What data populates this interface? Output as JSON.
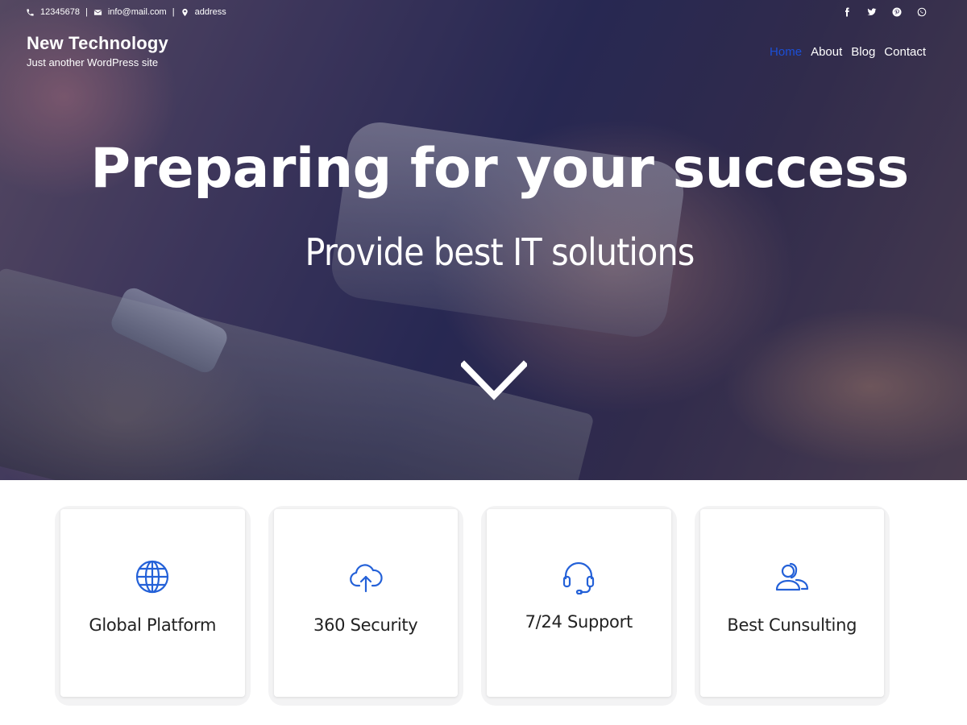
{
  "topbar": {
    "phone": "12345678",
    "email": "info@mail.com",
    "address": "address",
    "separator": "|",
    "social_icons": [
      "facebook-icon",
      "twitter-icon",
      "pinterest-icon",
      "whatsapp-icon"
    ]
  },
  "brand": {
    "title": "New Technology",
    "tagline": "Just another WordPress site"
  },
  "nav": {
    "items": [
      {
        "label": "Home",
        "active": true
      },
      {
        "label": "About"
      },
      {
        "label": "Blog"
      },
      {
        "label": "Contact"
      }
    ]
  },
  "hero": {
    "title": "Preparing for your success",
    "subtitle": "Provide best IT solutions"
  },
  "features": [
    {
      "label": "Global Platform",
      "icon": "globe-icon"
    },
    {
      "label": "360 Security",
      "icon": "cloud-upload-icon"
    },
    {
      "label": "7/24 Support",
      "icon": "headset-icon"
    },
    {
      "label": "Best Cunsulting",
      "icon": "users-icon"
    }
  ],
  "colors": {
    "accent": "#1b4fd6",
    "icon": "#2461d8"
  }
}
